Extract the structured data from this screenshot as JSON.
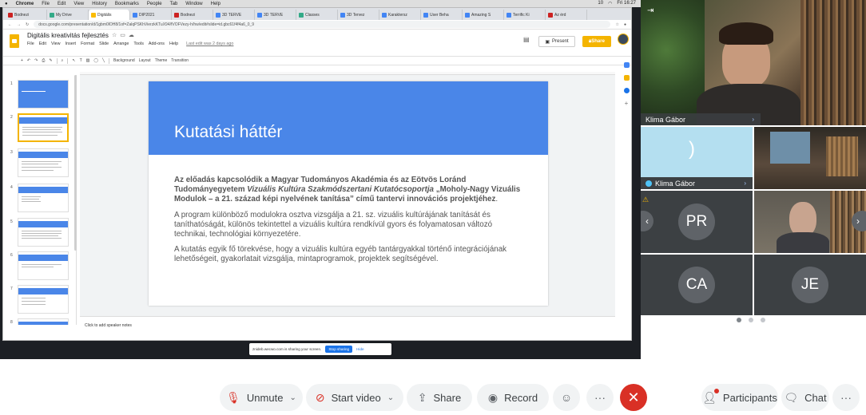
{
  "mac_menu": {
    "app": "Chrome",
    "items": [
      "File",
      "Edit",
      "View",
      "History",
      "Bookmarks",
      "People",
      "Tab",
      "Window",
      "Help"
    ],
    "clock": "Fri 16:27",
    "battery": "10"
  },
  "browser": {
    "tabs": [
      {
        "label": "Bodnezi",
        "icon": "gmail-icon"
      },
      {
        "label": "My Drive",
        "icon": "drive-icon"
      },
      {
        "label": "Digitális",
        "icon": "slides-icon",
        "active": true
      },
      {
        "label": "DIP2021",
        "icon": "docs-icon"
      },
      {
        "label": "Bodnezi",
        "icon": "gmail-icon"
      },
      {
        "label": "3D TERVE",
        "icon": "doc-icon"
      },
      {
        "label": "3D TERVE",
        "icon": "doc-icon"
      },
      {
        "label": "Classes",
        "icon": "classroom-icon"
      },
      {
        "label": "3D Tervez",
        "icon": "doc-icon"
      },
      {
        "label": "Karaktersz",
        "icon": "doc-icon"
      },
      {
        "label": "User Beha",
        "icon": "doc-icon"
      },
      {
        "label": "Amazing S",
        "icon": "doc-icon"
      },
      {
        "label": "Terrific Ki",
        "icon": "doc-icon"
      },
      {
        "label": "Az érd",
        "icon": "web-icon"
      }
    ],
    "url": "docs.google.com/presentation/d/1gbm0lOH8/1of=ZalqPSKhVierzkKTuX94/fVOFVezy-h/hw/edit#slide=id.gbc61f4f4a6_0_9"
  },
  "docs": {
    "title": "Digitális kreativitás fejlesztés",
    "menu": [
      "File",
      "Edit",
      "View",
      "Insert",
      "Format",
      "Slide",
      "Arrange",
      "Tools",
      "Add-ons",
      "Help"
    ],
    "last_edit": "Last edit was 2 days ago",
    "present_label": "Present",
    "share_label": "Share",
    "toolbar": {
      "background": "Background",
      "layout": "Layout",
      "theme": "Theme",
      "transition": "Transition"
    },
    "thumb_numbers": [
      "1",
      "2",
      "3",
      "4",
      "5",
      "6",
      "7",
      "8"
    ],
    "speaker_notes": "Click to add speaker notes"
  },
  "slide": {
    "title": "Kutatási háttér",
    "p1_intro": "Az előadás kapcsolódik a Magyar Tudományos Akadémia és az Eötvös Loránd Tudományegyetem ",
    "p1_italic": "Vizuális Kultúra Szakmódszertani Kutatócsoportja",
    "p1_project": " „Moholy-Nagy Vizuális Modulok – a 21. század képi nyelvének tanítása”",
    "p1_tail": " című tantervi innovációs projektjéhez",
    "p1_dot": ".",
    "p2": "A program különböző modulokra osztva vizsgálja a 21. sz. vizuális kultúrájának tanítását és taníthatóságát, különös tekintettel a vizuális kultúra rendkívül gyors és folyamatosan változó technikai, technológiai környezetére.",
    "p3": "A kutatás egyik fő törekvése, hogy a vizuális kultúra egyéb tantárgyakkal történő integrációjának lehetőségeit, gyakorlatait vizsgálja, mintaprogramok, projektek segítségével."
  },
  "share_notice": {
    "text": "znideb.wecwo.com is sharing your screen.",
    "stop": "Stop sharing",
    "hide": "Hide"
  },
  "participants": {
    "main_speaker": "Klima Gábor",
    "self_tile": "Klima Gábor",
    "initials": [
      "PR",
      "CA",
      "JE"
    ]
  },
  "controls": {
    "unmute": "Unmute",
    "start_video": "Start video",
    "share": "Share",
    "record": "Record",
    "more": "···",
    "participants": "Participants",
    "chat": "Chat",
    "overflow": "···"
  },
  "colors": {
    "slide_blue": "#4a86e8",
    "slides_yellow": "#f4b400",
    "end_red": "#d93025"
  }
}
